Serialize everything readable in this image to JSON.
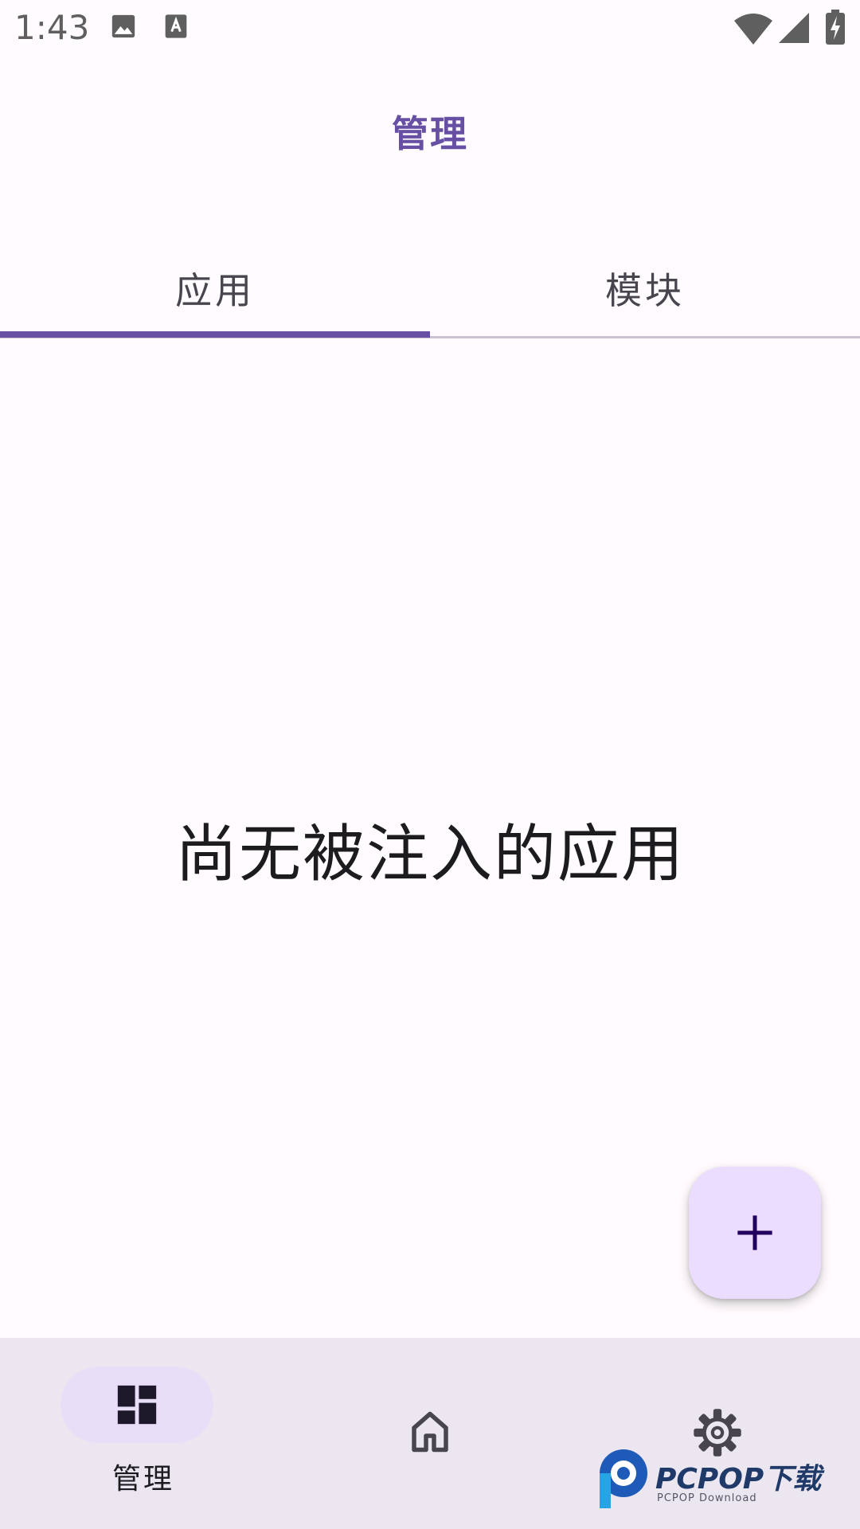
{
  "status_bar": {
    "time": "1:43",
    "icons": [
      "image-icon",
      "text-a-icon",
      "wifi-icon",
      "signal-icon",
      "battery-charging-icon"
    ]
  },
  "header": {
    "title": "管理"
  },
  "tabs": [
    {
      "label": "应用",
      "selected": true
    },
    {
      "label": "模块",
      "selected": false
    }
  ],
  "empty_state": {
    "message": "尚无被注入的应用"
  },
  "fab": {
    "icon": "add-icon"
  },
  "bottom_nav": [
    {
      "label": "管理",
      "icon": "dashboard-icon",
      "selected": true
    },
    {
      "label": "",
      "icon": "home-icon",
      "selected": false
    },
    {
      "label": "",
      "icon": "gear-icon",
      "selected": false
    }
  ],
  "watermark": {
    "text": "PCPOP下载",
    "sub": "PCPOP Download"
  },
  "colors": {
    "accent": "#6750a4",
    "background": "#fffbfe",
    "fab": "#eaddff",
    "nav_background": "#ece6f0",
    "nav_pill": "#e8def8"
  }
}
